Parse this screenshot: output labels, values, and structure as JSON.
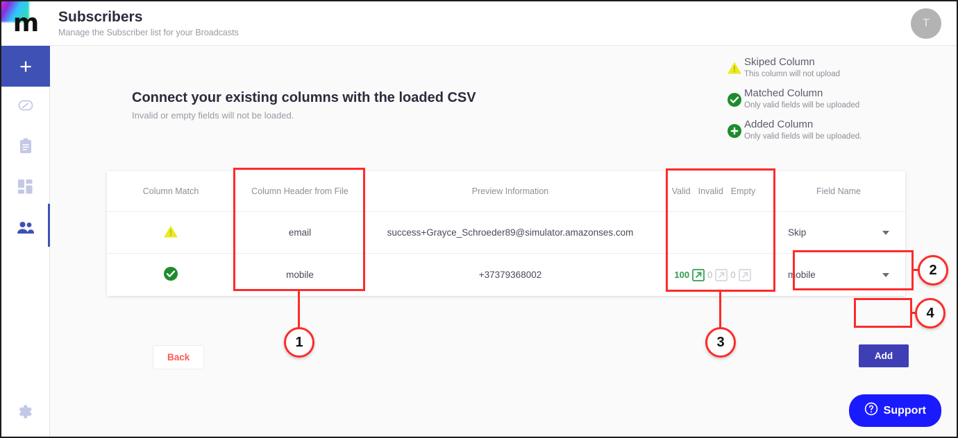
{
  "brand": {
    "logo_letter": "m",
    "accent": "#3f51b5"
  },
  "header": {
    "title": "Subscribers",
    "subtitle": "Manage the Subscriber list for your Broadcasts",
    "avatar_initial": "T"
  },
  "sidebar": {
    "items": [
      {
        "name": "add",
        "icon": "plus-icon",
        "active": true
      },
      {
        "name": "dashboard",
        "icon": "speedometer-icon",
        "active": false
      },
      {
        "name": "reports",
        "icon": "clipboard-icon",
        "active": false
      },
      {
        "name": "widgets",
        "icon": "grid-icon",
        "active": false
      },
      {
        "name": "subscribers",
        "icon": "people-icon",
        "active": true
      }
    ],
    "footer_item": {
      "name": "settings",
      "icon": "gear-icon"
    }
  },
  "legend": [
    {
      "icon": "warning-triangle-icon",
      "color": "#e8e82a",
      "title": "Skiped Column",
      "desc": "This column will not upload"
    },
    {
      "icon": "check-circle-icon",
      "color": "#1e8c2e",
      "title": "Matched Column",
      "desc": "Only valid fields will be uploaded"
    },
    {
      "icon": "plus-circle-icon",
      "color": "#1e8c2e",
      "title": "Added Column",
      "desc": "Only valid fields will be uploaded."
    }
  ],
  "main": {
    "heading": "Connect your existing columns with the loaded CSV",
    "subheading": "Invalid or empty fields will not be loaded."
  },
  "table": {
    "columns": [
      "Column Match",
      "Column Header from File",
      "Preview Information",
      "Valid",
      "Invalid",
      "Empty",
      "Field Name"
    ],
    "rows": [
      {
        "match_icon": "warning-triangle-icon",
        "match_status": "skipped",
        "column_header": "email",
        "preview": "success+Grayce_Schroeder89@simulator.amazonses.com",
        "valid": "",
        "invalid": "",
        "empty": "",
        "field_name": "Skip"
      },
      {
        "match_icon": "check-circle-icon",
        "match_status": "matched",
        "column_header": "mobile",
        "preview": "+37379368002",
        "valid": "100",
        "invalid": "0",
        "empty": "0",
        "field_name": "mobile"
      }
    ]
  },
  "actions": {
    "back_label": "Back",
    "add_label": "Add",
    "support_label": "Support"
  },
  "annotations": [
    {
      "number": "1"
    },
    {
      "number": "2"
    },
    {
      "number": "3"
    },
    {
      "number": "4"
    }
  ]
}
